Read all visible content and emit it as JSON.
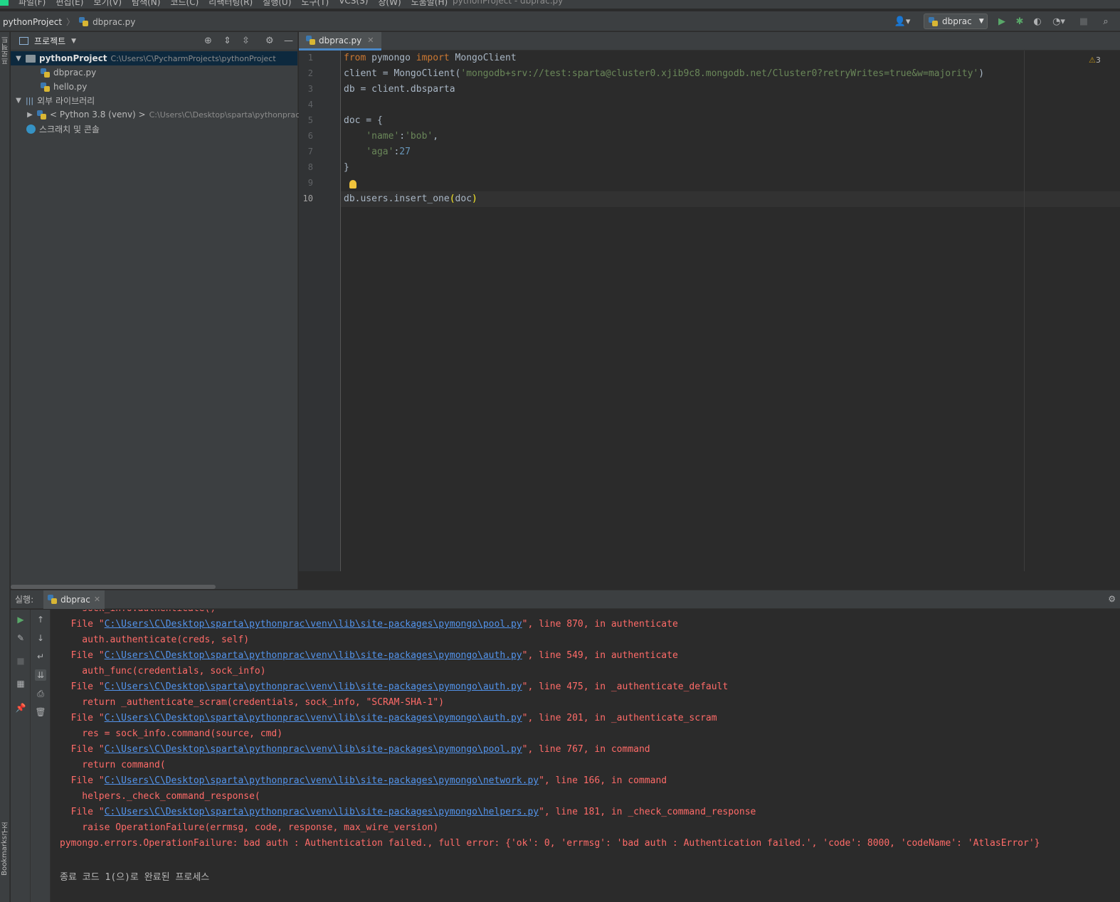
{
  "window": {
    "title": "pythonProject - dbprac.py",
    "menu": [
      "파일(F)",
      "편집(E)",
      "보기(V)",
      "탐색(N)",
      "코드(C)",
      "리팩터링(R)",
      "실행(U)",
      "도구(T)",
      "VCS(S)",
      "창(W)",
      "도움말(H)"
    ]
  },
  "navbar": {
    "project": "pythonProject",
    "file": "dbprac.py",
    "run_config": "dbprac"
  },
  "left_strip": {
    "top_label": "프로젝트",
    "structure_label": "구조",
    "bookmarks_label": "Bookmarks"
  },
  "project_panel": {
    "title": "프로젝트",
    "root_name": "pythonProject",
    "root_path": "C:\\Users\\C\\PycharmProjects\\pythonProject",
    "files": [
      "dbprac.py",
      "hello.py"
    ],
    "external_libs": "외부 라이브러리",
    "python_sdk": "< Python 3.8 (venv) >",
    "python_sdk_path": "C:\\Users\\C\\Desktop\\sparta\\pythonprac",
    "scratches": "스크래치 및 콘솔"
  },
  "editor": {
    "tab": "dbprac.py",
    "warnings": "3",
    "current_line": "10",
    "line_numbers": [
      "1",
      "2",
      "3",
      "4",
      "5",
      "6",
      "7",
      "8",
      "9",
      "10"
    ]
  },
  "run_panel": {
    "label": "실행:",
    "tab": "dbprac",
    "lines": [
      {
        "type": "plain",
        "text": "    sock_info.authenticate()"
      },
      {
        "type": "file",
        "path": "C:\\Users\\C\\Desktop\\sparta\\pythonprac\\venv\\lib\\site-packages\\pymongo\\pool.py",
        "rest": "\", line 870, in authenticate"
      },
      {
        "type": "plain",
        "text": "    auth.authenticate(creds, self)"
      },
      {
        "type": "file",
        "path": "C:\\Users\\C\\Desktop\\sparta\\pythonprac\\venv\\lib\\site-packages\\pymongo\\auth.py",
        "rest": "\", line 549, in authenticate"
      },
      {
        "type": "plain",
        "text": "    auth_func(credentials, sock_info)"
      },
      {
        "type": "file",
        "path": "C:\\Users\\C\\Desktop\\sparta\\pythonprac\\venv\\lib\\site-packages\\pymongo\\auth.py",
        "rest": "\", line 475, in _authenticate_default"
      },
      {
        "type": "plain",
        "text": "    return _authenticate_scram(credentials, sock_info, \"SCRAM-SHA-1\")"
      },
      {
        "type": "file",
        "path": "C:\\Users\\C\\Desktop\\sparta\\pythonprac\\venv\\lib\\site-packages\\pymongo\\auth.py",
        "rest": "\", line 201, in _authenticate_scram"
      },
      {
        "type": "plain",
        "text": "    res = sock_info.command(source, cmd)"
      },
      {
        "type": "file",
        "path": "C:\\Users\\C\\Desktop\\sparta\\pythonprac\\venv\\lib\\site-packages\\pymongo\\pool.py",
        "rest": "\", line 767, in command"
      },
      {
        "type": "plain",
        "text": "    return command("
      },
      {
        "type": "file",
        "path": "C:\\Users\\C\\Desktop\\sparta\\pythonprac\\venv\\lib\\site-packages\\pymongo\\network.py",
        "rest": "\", line 166, in command"
      },
      {
        "type": "plain",
        "text": "    helpers._check_command_response("
      },
      {
        "type": "file",
        "path": "C:\\Users\\C\\Desktop\\sparta\\pythonprac\\venv\\lib\\site-packages\\pymongo\\helpers.py",
        "rest": "\", line 181, in _check_command_response"
      },
      {
        "type": "plain",
        "text": "    raise OperationFailure(errmsg, code, response, max_wire_version)"
      },
      {
        "type": "plain",
        "text": "pymongo.errors.OperationFailure: bad auth : Authentication failed., full error: {'ok': 0, 'errmsg': 'bad auth : Authentication failed.', 'code': 8000, 'codeName': 'AtlasError'}"
      },
      {
        "type": "plain",
        "text": ""
      },
      {
        "type": "exit",
        "text": "종료 코드 1(으)로 완료된 프로세스"
      }
    ]
  },
  "colors": {
    "keyword": "#cc7832",
    "string": "#6a8759",
    "number": "#6897bb",
    "error_text": "#ff6b68",
    "link": "#5394ec"
  }
}
